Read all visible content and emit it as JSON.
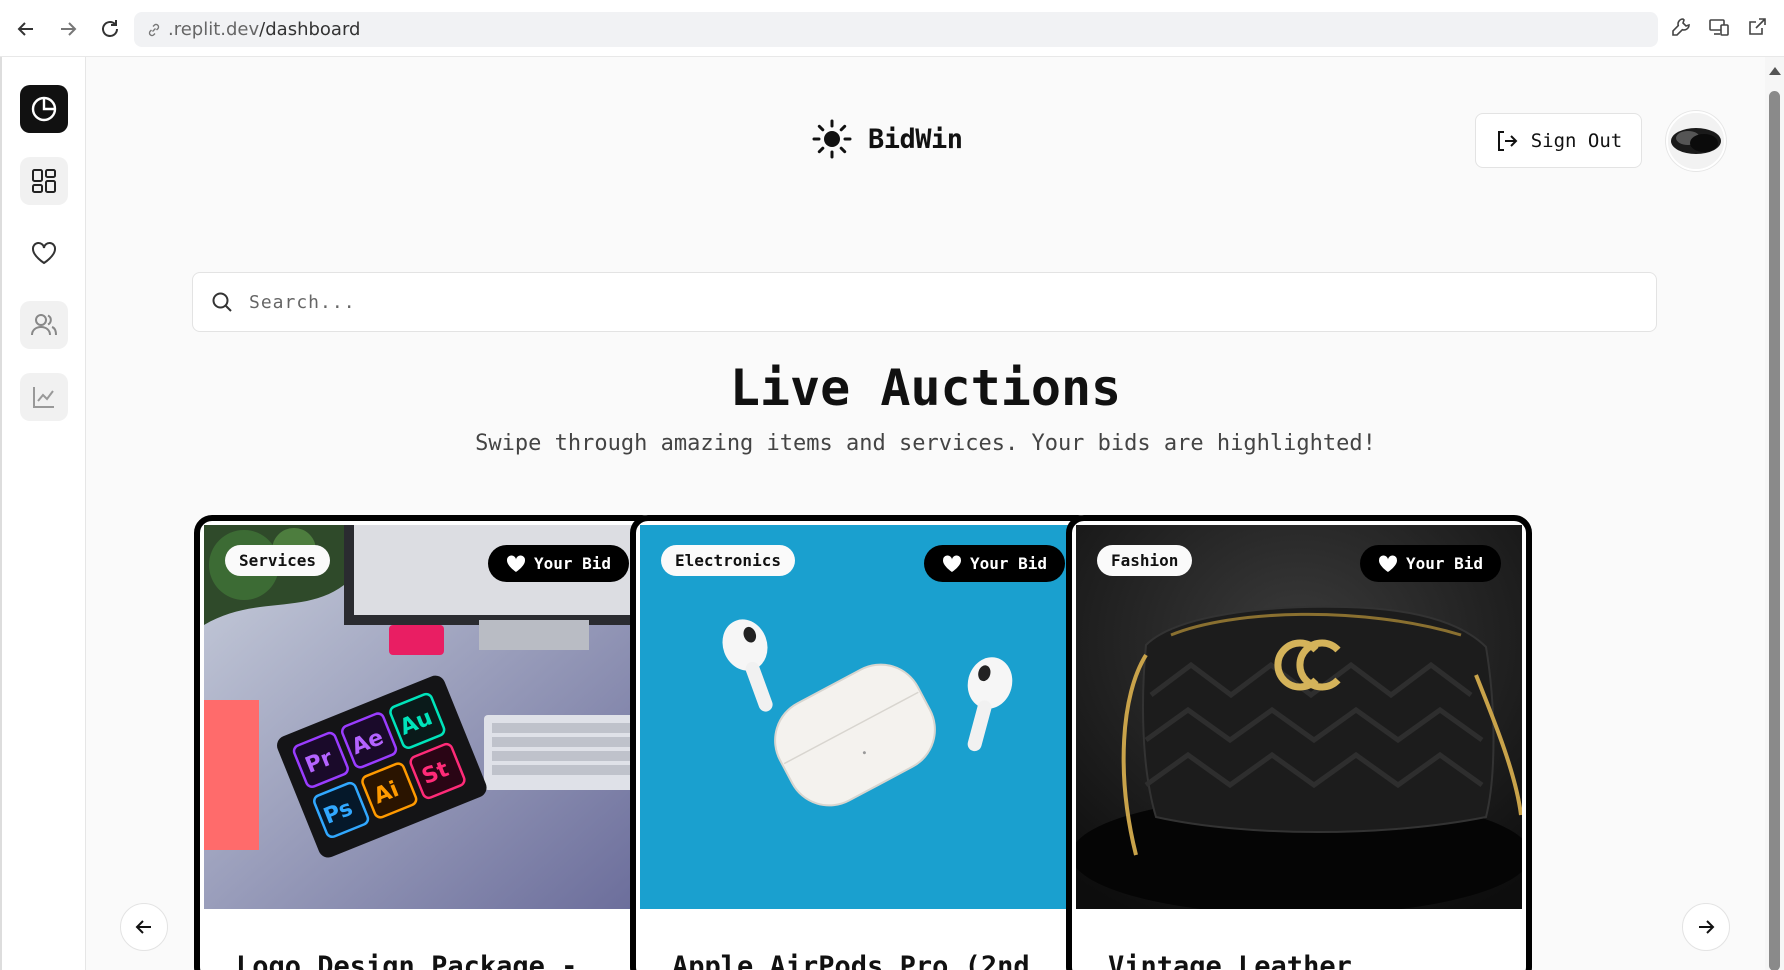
{
  "browser": {
    "url_prefix": ".replit.dev",
    "url_path": "/dashboard"
  },
  "sidebar": {
    "items": [
      {
        "icon": "clock-chart-icon",
        "active": true
      },
      {
        "icon": "grid-icon",
        "active": false
      },
      {
        "icon": "heart-icon",
        "active": false
      },
      {
        "icon": "users-icon",
        "active": false
      },
      {
        "icon": "line-chart-icon",
        "active": false
      }
    ]
  },
  "header": {
    "brand": "BidWin",
    "signout_label": "Sign Out"
  },
  "search": {
    "placeholder": "Search..."
  },
  "hero": {
    "title": "Live Auctions",
    "subtitle": "Swipe through amazing items and services. Your bids are highlighted!"
  },
  "cards": [
    {
      "category": "Services",
      "bid_label": "Your Bid",
      "title": "Logo Design Package -"
    },
    {
      "category": "Electronics",
      "bid_label": "Your Bid",
      "title": "Apple AirPods Pro (2nd"
    },
    {
      "category": "Fashion",
      "bid_label": "Your Bid",
      "title": "Vintage Leather"
    }
  ],
  "colors": {
    "accent": "#000000",
    "background": "#fafafa",
    "airpods_bg": "#1aa0cf"
  }
}
